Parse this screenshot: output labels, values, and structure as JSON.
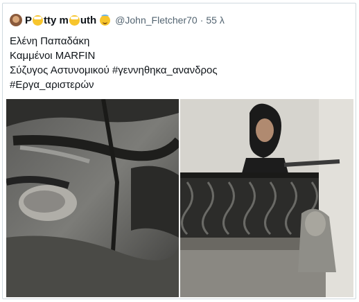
{
  "tweet": {
    "display_name_parts": [
      "P",
      "tty m",
      "uth"
    ],
    "handle": "@John_Fletcher70",
    "separator": "·",
    "time": "55 λ",
    "lines": [
      "Ελένη Παπαδάκη",
      "Καμμένοι MARFIN",
      "Σύζυγος Αστυνομικού #γεννηθηκα_ανανδρος",
      "#Εργα_αριστερών"
    ]
  },
  "icons": {
    "avatar": "avatar-icon",
    "emoji_grin": "grinning-face-emoji",
    "emoji_halo": "smiling-face-with-halo-emoji"
  },
  "media": {
    "left": "black-and-white-photo",
    "right": "balcony-photo"
  },
  "colors": {
    "text": "#0f1419",
    "secondary": "#536471",
    "border": "#cfd9de"
  }
}
